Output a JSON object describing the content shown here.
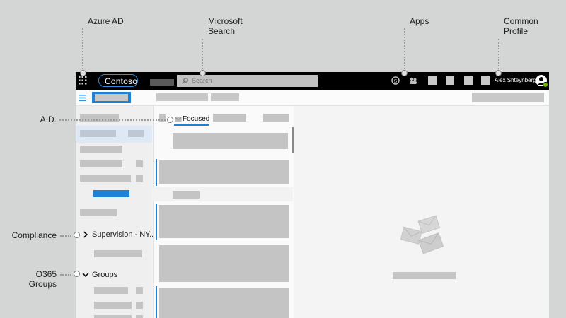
{
  "callouts": {
    "azure_ad": "Azure AD",
    "microsoft_search_1": "Microsoft",
    "microsoft_search_2": "Search",
    "apps": "Apps",
    "common_profile_1": "Common",
    "common_profile_2": "Profile",
    "ad": "A.D.",
    "compliance": "Compliance",
    "o365_groups_1": "O365",
    "o365_groups_2": "Groups"
  },
  "app": {
    "logo": "Contoso",
    "search_placeholder": "Search",
    "user_name": "Alex Shteynberg",
    "focused_tab": "Focused",
    "folder_supervision": "Supervision - NY...",
    "folder_groups": "Groups"
  },
  "colors": {
    "accent": "#1e82d6",
    "topbar": "#000000",
    "presence": "#6bb700"
  }
}
